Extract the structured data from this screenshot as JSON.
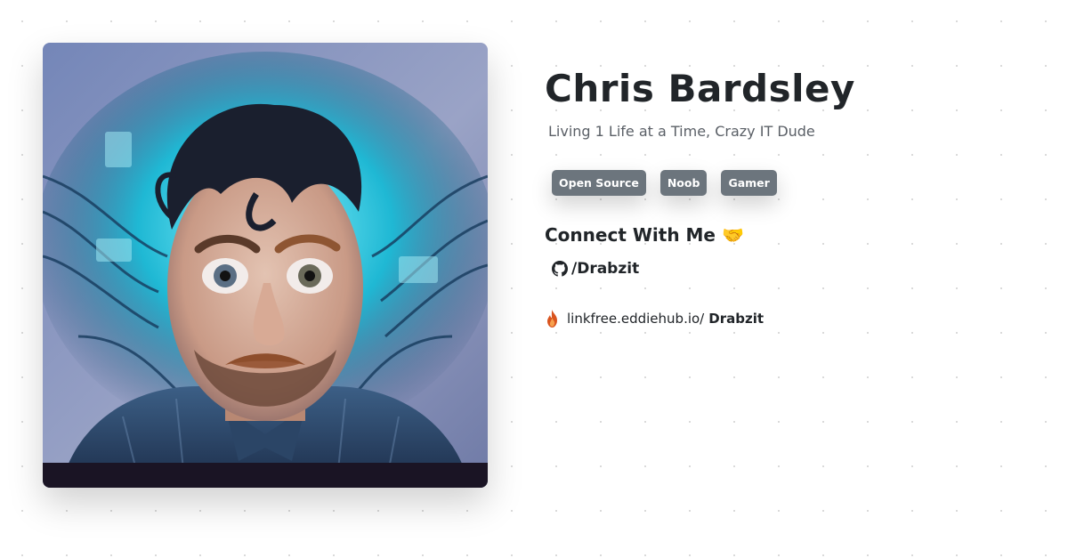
{
  "profile": {
    "name": "Chris Bardsley",
    "tagline": "Living 1 Life at a Time, Crazy IT Dude",
    "avatar_icon": "profile-portrait"
  },
  "tags": [
    {
      "label": "Open Source"
    },
    {
      "label": "Noob"
    },
    {
      "label": "Gamer"
    }
  ],
  "connect": {
    "heading": "Connect With Me 🤝",
    "github": {
      "icon": "github-icon",
      "handle": "/Drabzit"
    },
    "linkfree": {
      "icon": "flame-icon",
      "host": "linkfree.eddiehub.io/",
      "user": "Drabzit"
    }
  },
  "colors": {
    "tag_bg": "#6c757d",
    "text": "#212529",
    "muted": "#5a5f66"
  }
}
